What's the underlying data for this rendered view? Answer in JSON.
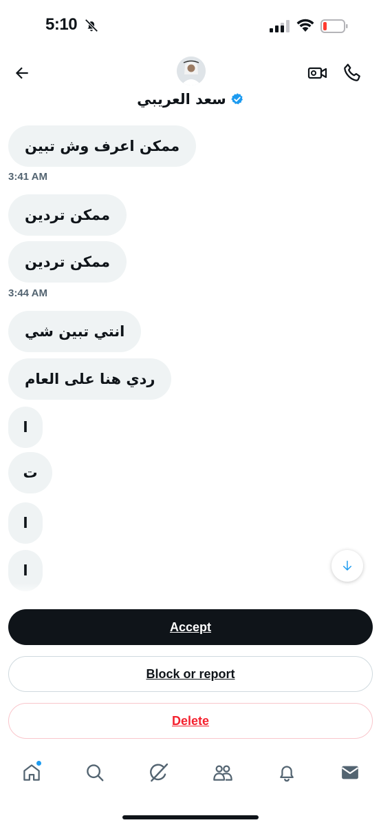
{
  "status_bar": {
    "time": "5:10",
    "icons": [
      "bell-slash-icon",
      "cellular-signal-icon",
      "wifi-icon",
      "battery-low-icon"
    ],
    "battery_color": "#ff3b30"
  },
  "header": {
    "contact_name": "سعد العريبي",
    "verified": true,
    "icons": [
      "back-arrow-icon",
      "video-call-icon",
      "phone-icon"
    ]
  },
  "messages": [
    {
      "text": "ممكن اعرف وش تبين"
    },
    {
      "timestamp": "3:41 AM"
    },
    {
      "text": "ممكن تردين"
    },
    {
      "text": "ممكن تردين"
    },
    {
      "timestamp": "3:44 AM"
    },
    {
      "text": "انتي تبين شي"
    },
    {
      "text": "ردي هنا على العام"
    },
    {
      "text": "ا"
    },
    {
      "text": "ت"
    },
    {
      "text": "ا"
    },
    {
      "text": "ا"
    }
  ],
  "actions": {
    "accept": "Accept",
    "block_or_report": "Block or report",
    "delete": "Delete"
  },
  "bottom_nav": {
    "items": [
      "home-icon",
      "search-icon",
      "grok-icon",
      "communities-icon",
      "notifications-icon",
      "messages-icon"
    ],
    "home_has_badge": true
  },
  "colors": {
    "accent": "#1d9bf0",
    "danger": "#f4212e",
    "bubble_bg": "#eff3f4",
    "text": "#0f1419",
    "muted": "#536471"
  }
}
